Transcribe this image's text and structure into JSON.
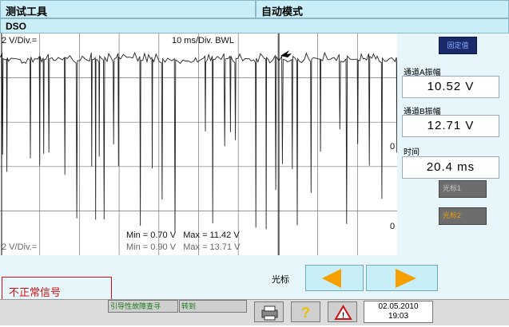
{
  "header": {
    "tool_title": "测试工具",
    "mode_title": "自动模式",
    "subtitle": "DSO"
  },
  "scope": {
    "ch_a_scale": "2 V/Div.=",
    "ch_b_scale": "2 V/Div.=",
    "time_scale": "10 ms/Div. BWL",
    "zero_a": "0",
    "zero_b": "0",
    "stats_a": "Min = 0.70 V   Max = 11.42 V",
    "stats_b": "Min = 0.90 V   Max = 13.71 V"
  },
  "side_panel": {
    "fixed_btn": "固定值",
    "ch_a_label": "通道A振幅",
    "ch_a_value": "10.52  V",
    "ch_b_label": "通道B振幅",
    "ch_b_value": "12.71  V",
    "time_label": "时间",
    "time_value": "20.4  ms",
    "cursor1_btn": "光标1",
    "cursor2_btn": "光标2"
  },
  "cursor_controls": {
    "label": "光标"
  },
  "annotation": {
    "text": "不正常信号"
  },
  "footer": {
    "fault_btn": "引导性故障查寻",
    "goto_btn": "转到",
    "date": "02.05.2010",
    "time": "19:03"
  },
  "colors": {
    "header_bg": "#c9eef8",
    "accent_orange": "#f5a000",
    "annotation_red": "#d01010"
  }
}
